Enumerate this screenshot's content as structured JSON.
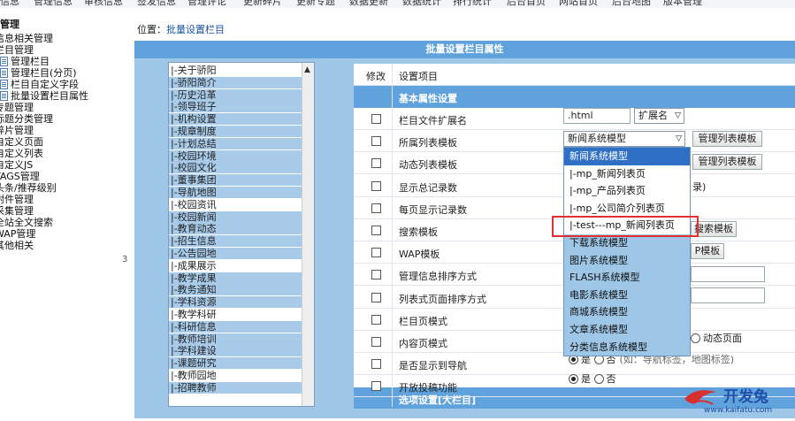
{
  "topbar": {
    "items": [
      "信息",
      "管理信息",
      "审核信息",
      "签发信息",
      "管理评论",
      "更新碎片",
      "更新专题",
      "数据更新",
      "数据统计",
      "排行统计",
      "后台首页",
      "网站首页",
      "后台地图",
      "版本管理"
    ]
  },
  "sidebar": {
    "items": [
      "管理",
      "信息相关管理",
      "栏目管理",
      "管理栏目",
      "管理栏目(分页)",
      "栏目自定义字段",
      "批量设置栏目属性",
      "专题管理",
      "标题分类管理",
      "碎片管理",
      "自定义页面",
      "自定义列表",
      "自定义JS",
      "TAGS管理",
      "头条/推荐级别",
      "附件管理",
      "采集管理",
      "全站全文搜索",
      "WAP管理",
      "其他相关"
    ],
    "marker": "3"
  },
  "breadcrumb": {
    "prefix": "位置：",
    "link": "批量设置栏目"
  },
  "panel": {
    "title": "批量设置栏目属性"
  },
  "column_list": {
    "options": [
      "|-关于骄阳",
      "|-骄阳简介",
      "|-历史沿革",
      "|-领导班子",
      "|-机构设置",
      "|-规章制度",
      "|-计划总结",
      "|-校园环境",
      "|-校园文化",
      "|-董事集团",
      "|-导航地图",
      "|-校园资讯",
      "|-校园新闻",
      "|-教育动态",
      "|-招生信息",
      "|-公告园地",
      "|-成果展示",
      "|-教学成果",
      "|-教务通知",
      "|-学科资源",
      "|-教学科研",
      "|-科研信息",
      "|-教师培训",
      "|-学科建设",
      "|-课题研究",
      "|-教师园地",
      "|-招聘教师"
    ],
    "selected": [
      1,
      2,
      3,
      4,
      5,
      6,
      7,
      8,
      9,
      10,
      12,
      13,
      14,
      15,
      17,
      18,
      19,
      21,
      22,
      23,
      24,
      26
    ]
  },
  "settings": {
    "col_modify": "修改",
    "col_item": "设置项目",
    "section_basic": "基本属性设置",
    "rows": [
      "栏目文件扩展名",
      "所属列表模板",
      "动态列表模板",
      "显示总记录数",
      "每页显示记录数",
      "搜索模板",
      "WAP模板",
      "管理信息排序方式",
      "列表式页面排序方式",
      "栏目页模式",
      "内容页模式",
      "是否显示到导航",
      "开放投稿功能"
    ],
    "section_options": "选项设置[大栏目]",
    "ext_value": ".html",
    "ext_select": "扩展名",
    "list_tpl_value": "新闻系统模型",
    "manage_list_tpl_btn": "管理列表模板",
    "manage_list_tpl_btn2": "管理列表模板",
    "search_btn_tail": "搜索模板",
    "wap_btn_tail": "P模板",
    "show_total_tail": "录)",
    "content_dynamic": "动态页面",
    "nav_yes": "是",
    "nav_no": "否",
    "nav_note": "(如：导航标签，地图标签)",
    "submit_yes": "是",
    "submit_no": "否"
  },
  "dropdown": {
    "items": [
      "新闻系统模型",
      "|-mp_新闻列表页",
      "|-mp_产品列表页",
      "|-mp_公司简介列表页",
      "|-test---mp_新闻列表页",
      "下载系统模型",
      "图片系统模型",
      "FLASH系统模型",
      "电影系统模型",
      "商城系统模型",
      "文章系统模型",
      "分类信息系统模型"
    ],
    "highlighted_index": 0,
    "outlined_index": 4
  },
  "watermark": {
    "brand": "开发兔",
    "url": "www.kaifatu.com"
  },
  "colors": {
    "accent": "#5fa2dc",
    "panel": "#9ec6e7",
    "highlight": "#e03030",
    "selection": "#2f6fc6"
  }
}
